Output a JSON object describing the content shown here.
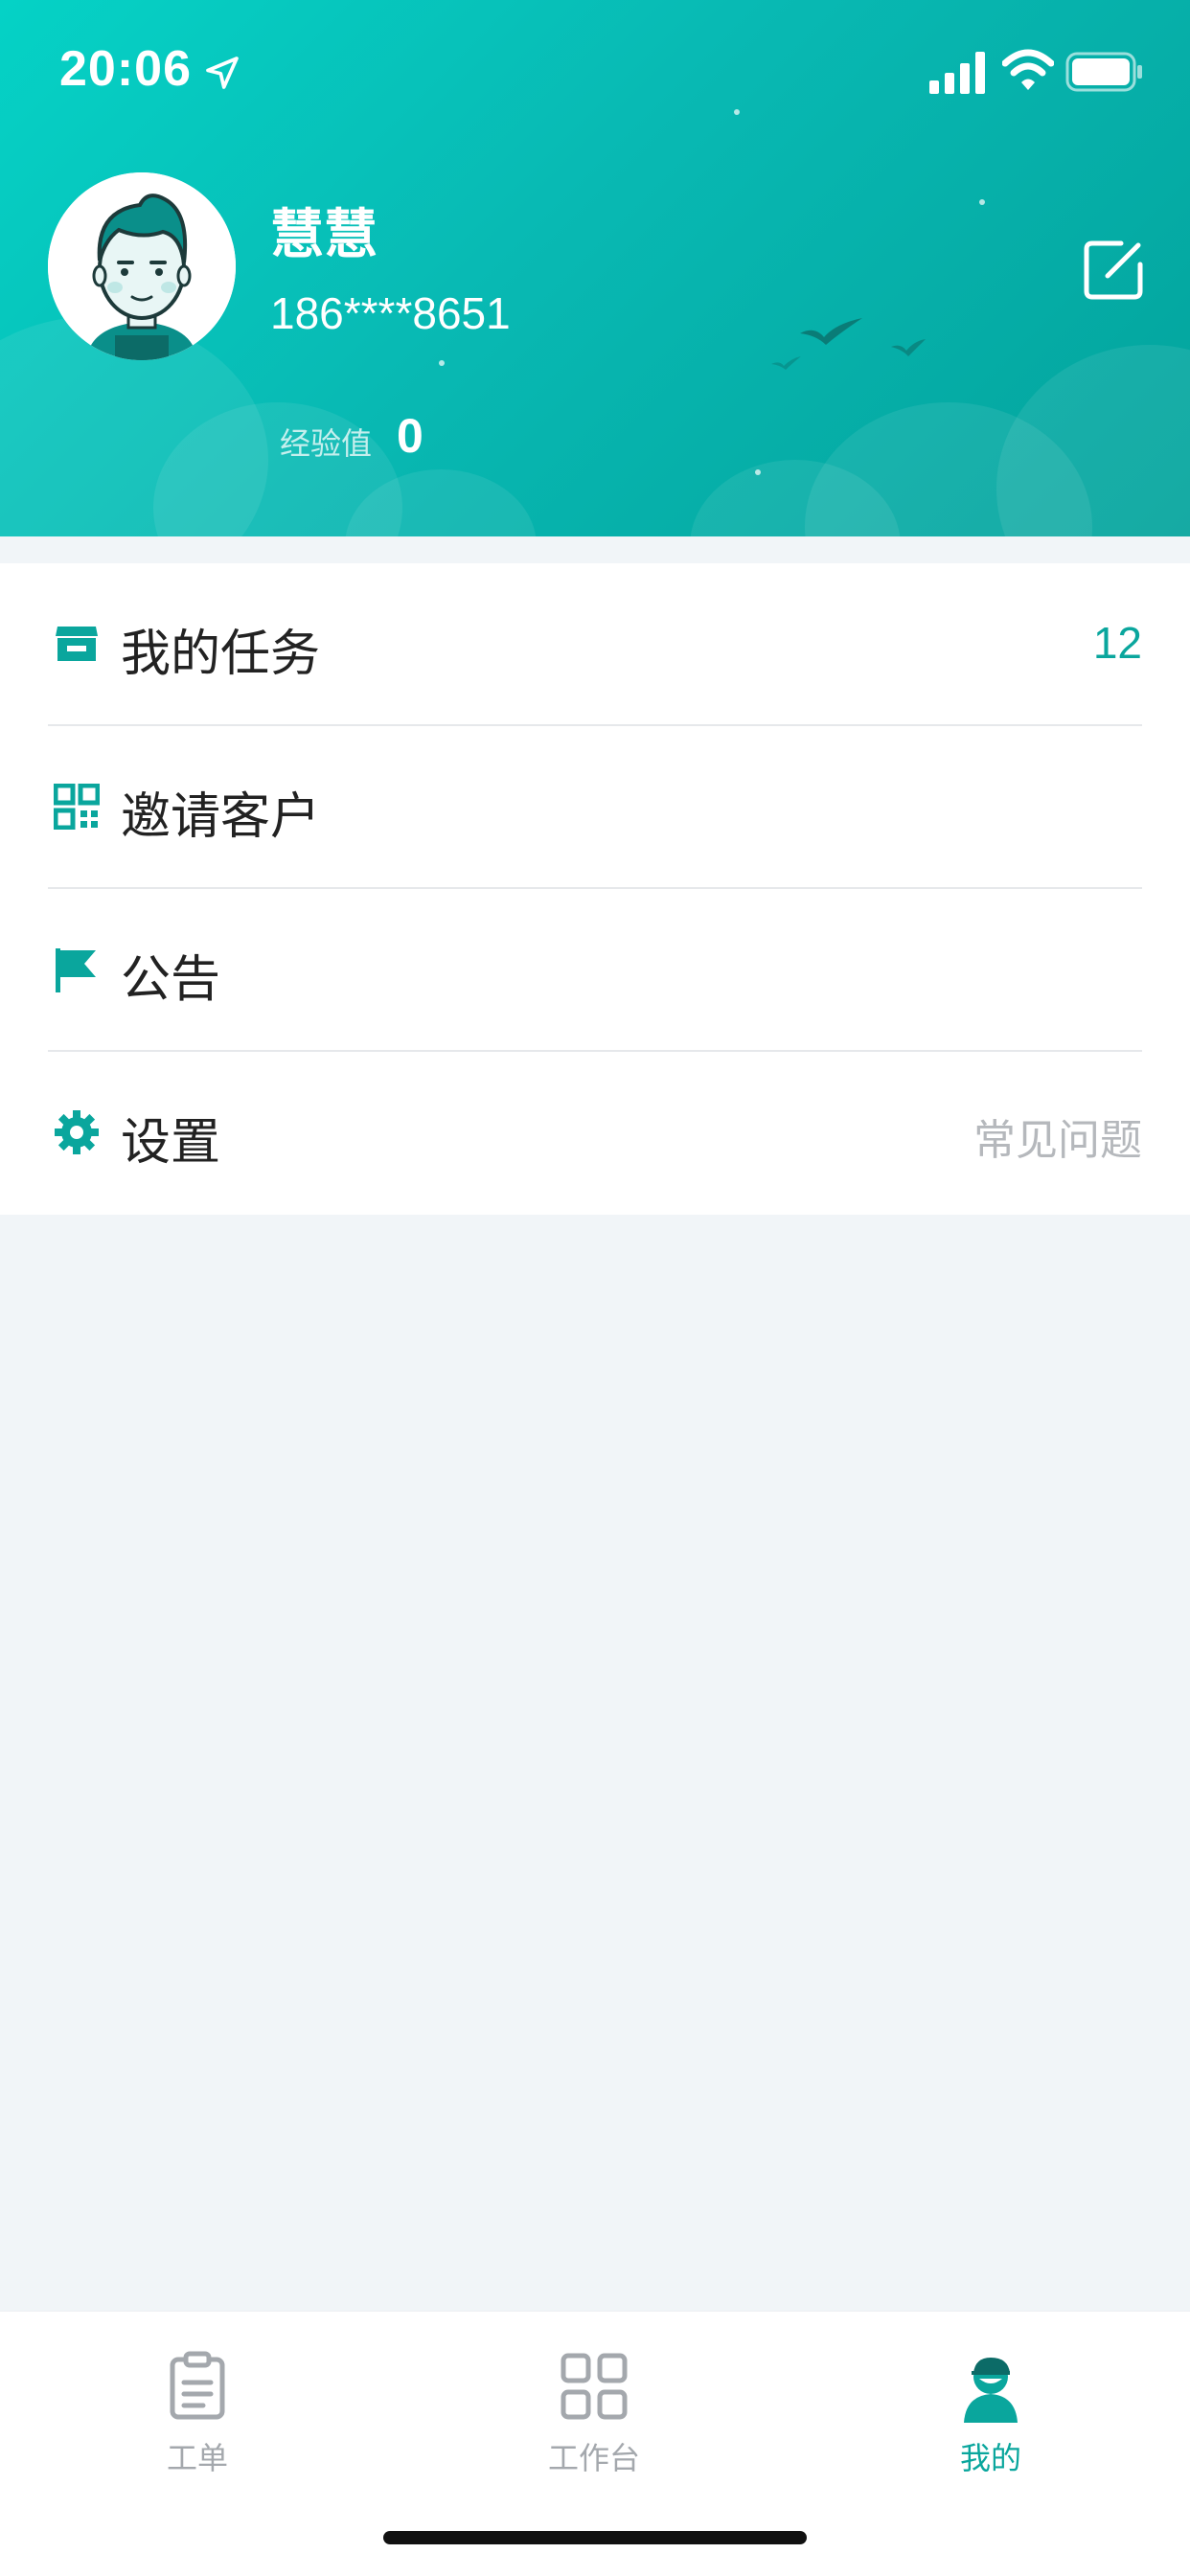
{
  "status_bar": {
    "time": "20:06"
  },
  "profile": {
    "name": "慧慧",
    "phone": "186****8651",
    "exp_label": "经验值",
    "exp_value": "0"
  },
  "menu": {
    "items": [
      {
        "label": "我的任务",
        "icon": "store-icon",
        "badge": "12"
      },
      {
        "label": "邀请客户",
        "icon": "qr-code-icon"
      },
      {
        "label": "公告",
        "icon": "flag-icon"
      },
      {
        "label": "设置",
        "icon": "gear-icon",
        "extra": "常见问题"
      }
    ]
  },
  "tabbar": {
    "tabs": [
      {
        "label": "工单",
        "icon": "clipboard-icon",
        "active": false
      },
      {
        "label": "工作台",
        "icon": "grid-icon",
        "active": false
      },
      {
        "label": "我的",
        "icon": "user-icon",
        "active": true
      }
    ]
  },
  "colors": {
    "accent": "#0aa69d",
    "header_gradient_start": "#05d2c6",
    "header_gradient_end": "#03a39c",
    "page_background": "#f1f5f8",
    "inactive": "#a4a8ad"
  }
}
